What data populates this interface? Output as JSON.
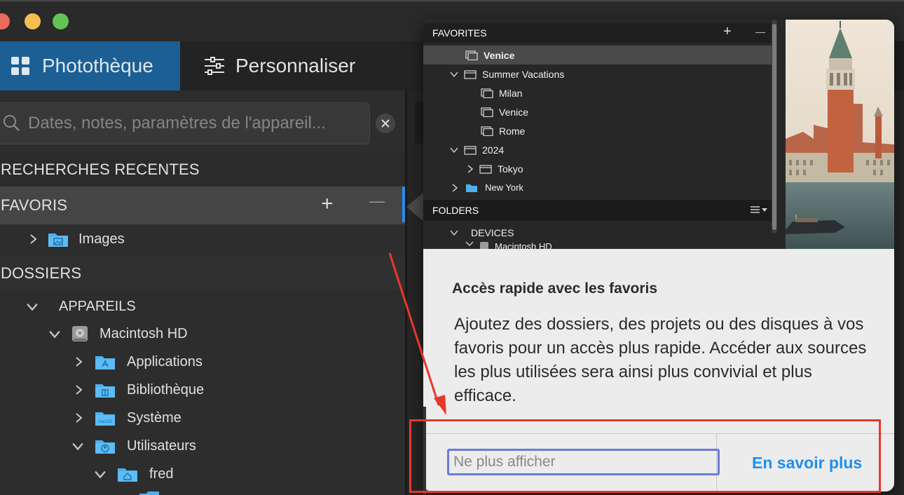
{
  "window": {
    "traffic_lights": [
      "#ec6a5e",
      "#f4bf4f",
      "#61c554"
    ]
  },
  "tabs": {
    "library": {
      "label": "Photothèque",
      "icon": "grid-icon"
    },
    "customize": {
      "label": "Personnaliser",
      "icon": "sliders-icon"
    }
  },
  "search": {
    "placeholder": "Dates, notes, paramètres de l'appareil...",
    "icon": "search-icon",
    "clear_icon": "close-icon"
  },
  "sidebar": {
    "recent_searches": "RECHERCHES RECENTES",
    "favorites": {
      "label": "FAVORIS",
      "add": "+",
      "remove": "—",
      "items": [
        {
          "label": "Images"
        }
      ]
    },
    "folders": {
      "label": "DOSSIERS",
      "devices": "APPAREILS",
      "disk": "Macintosh HD",
      "items": [
        {
          "label": "Applications"
        },
        {
          "label": "Bibliothèque"
        },
        {
          "label": "Système"
        },
        {
          "label": "Utilisateurs"
        },
        {
          "label": "fred"
        }
      ],
      "systeme_badge": "macOS"
    }
  },
  "popover": {
    "screenshot": {
      "favorites_header": "FAVORITES",
      "add": "+",
      "remove": "—",
      "rows": [
        {
          "label": "Venice"
        },
        {
          "label": "Summer Vacations"
        },
        {
          "label": "Milan"
        },
        {
          "label": "Venice"
        },
        {
          "label": "Rome"
        },
        {
          "label": "2024"
        },
        {
          "label": "Tokyo"
        },
        {
          "label": "New York"
        }
      ],
      "folders_header": "FOLDERS",
      "devices": "DEVICES",
      "disk_partial": "Macintosh HD"
    },
    "title": "Accès rapide avec les favoris",
    "body": "Ajoutez des dossiers, des projets ou des disques à vos favoris pour un accès plus rapide. Accéder aux sources les plus utilisées sera ainsi plus convivial et plus efficace.",
    "dont_show": "Ne plus afficher",
    "learn_more": "En savoir plus"
  },
  "colors": {
    "accent": "#1b5f95",
    "link": "#1f8ef1",
    "annotation": "#e8372c",
    "focus": "#6b7bdc"
  }
}
